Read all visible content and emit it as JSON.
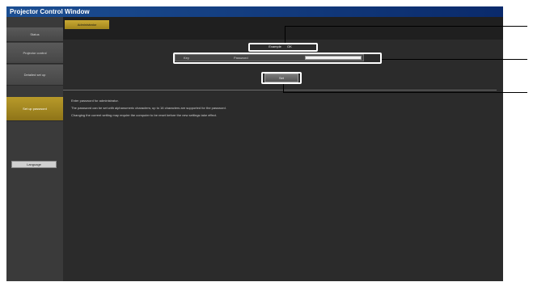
{
  "window": {
    "title": "Projector Control Window"
  },
  "sidebar": {
    "items": [
      {
        "label": "Status"
      },
      {
        "label": "Projector control"
      },
      {
        "label": "Detailed set up"
      },
      {
        "label": "Set up password"
      }
    ],
    "language_button": "Language"
  },
  "tab": {
    "label": "Administrator"
  },
  "form": {
    "status_left": "Example",
    "status_right": "OK",
    "label_1": "Key",
    "label_2": "Password",
    "set_button": "Set"
  },
  "notes": [
    "Enter password for administrator.",
    "The password can be set with alphanumeric characters; up to 16 characters are supported for the password.",
    "Changing the current setting may require the computer to be reset before the new settings take effect."
  ]
}
